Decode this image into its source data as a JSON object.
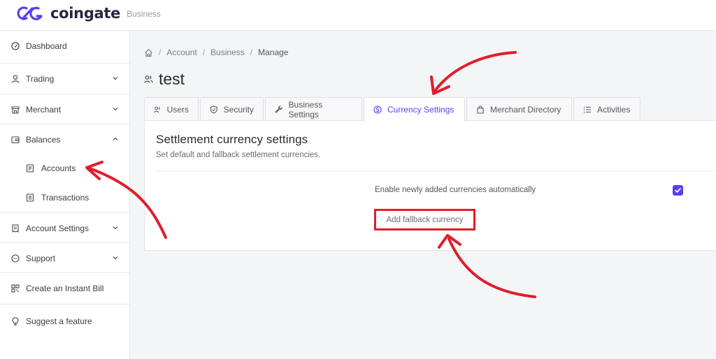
{
  "header": {
    "brand": "coingate",
    "product": "Business"
  },
  "sidebar": {
    "items": [
      {
        "label": "Dashboard"
      },
      {
        "label": "Trading"
      },
      {
        "label": "Merchant"
      },
      {
        "label": "Balances"
      },
      {
        "label": "Accounts"
      },
      {
        "label": "Transactions"
      },
      {
        "label": "Account Settings"
      },
      {
        "label": "Support"
      },
      {
        "label": "Create an Instant Bill"
      },
      {
        "label": "Suggest a feature"
      }
    ]
  },
  "breadcrumb": {
    "items": [
      "Account",
      "Business",
      "Manage"
    ]
  },
  "page": {
    "title": "test"
  },
  "tabs": [
    {
      "label": "Users"
    },
    {
      "label": "Security"
    },
    {
      "label": "Business Settings"
    },
    {
      "label": "Currency Settings"
    },
    {
      "label": "Merchant Directory"
    },
    {
      "label": "Activities"
    }
  ],
  "settings": {
    "title": "Settlement currency settings",
    "description": "Set default and fallback settlement currencies.",
    "auto_enable_label": "Enable newly added currencies automatically",
    "auto_enable_checked": true,
    "fallback_button": "Add fallback currency"
  },
  "colors": {
    "accent": "#5b3df5",
    "annotation": "#e11d2b"
  }
}
